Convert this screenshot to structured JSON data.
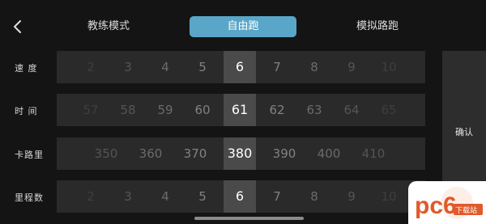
{
  "tabs": {
    "coach": "教练模式",
    "free": "自由跑",
    "sim": "模拟路跑"
  },
  "rows": [
    {
      "label": "速 度",
      "values": [
        "2",
        "3",
        "4",
        "5",
        "6",
        "7",
        "8",
        "9",
        "10"
      ],
      "selected": "6"
    },
    {
      "label": "时 间",
      "values": [
        "57",
        "58",
        "59",
        "60",
        "61",
        "62",
        "63",
        "64",
        "65"
      ],
      "selected": "61"
    },
    {
      "label": "卡路里",
      "values": [
        "350",
        "360",
        "370",
        "380",
        "390",
        "400",
        "410"
      ],
      "selected": "380"
    },
    {
      "label": "里程数",
      "values": [
        "2",
        "3",
        "4",
        "5",
        "6",
        "7",
        "8",
        "9",
        "10"
      ],
      "selected": "6"
    }
  ],
  "confirm": "确认",
  "watermark": {
    "brand": "pc6",
    "sub": "下载站"
  }
}
